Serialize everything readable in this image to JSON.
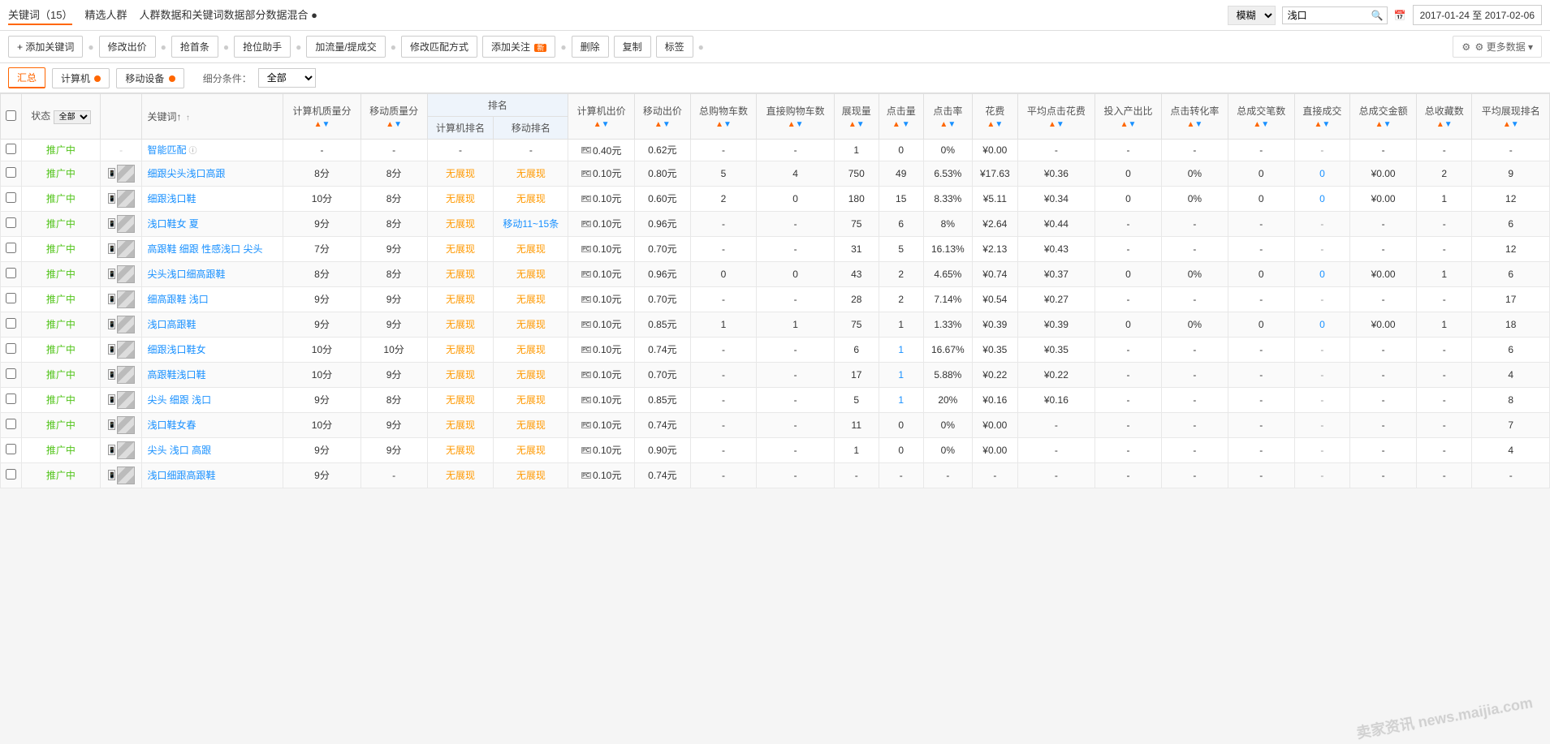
{
  "topBar": {
    "tabs": [
      {
        "id": "keywords",
        "label": "关键词（15）",
        "active": true
      },
      {
        "id": "target",
        "label": "精选人群",
        "active": false
      },
      {
        "id": "combined",
        "label": "人群数据和关键词数据部分数据混合 ●",
        "active": false
      }
    ],
    "filterSelect": "模糊",
    "filterSelect2": "浅口",
    "searchPlaceholder": "",
    "dateRange": "2017-01-24 至 2017-02-06"
  },
  "toolbar": {
    "addKeyword": "+ 添加关键词",
    "modifyBid": "修改出价",
    "topBid": "抢首条",
    "assistBid": "抢位助手",
    "boostFlow": "加流量/提成交",
    "modifyMatch": "修改匹配方式",
    "addFollow": "添加关注",
    "followNew": "新",
    "delete": "删除",
    "copy": "复制",
    "tag": "标签",
    "moreData": "⚙ 更多数据"
  },
  "filterBar": {
    "tabs": [
      {
        "id": "summary",
        "label": "汇总",
        "active": true
      },
      {
        "id": "pc",
        "label": "计算机",
        "active": false,
        "dot": true
      },
      {
        "id": "mobile",
        "label": "移动设备",
        "active": false,
        "dot": true
      }
    ],
    "subFilterLabel": "细分条件：",
    "subFilterValue": "全部"
  },
  "tableHeaders": {
    "select": "",
    "status": "状态",
    "statusFilter": "全部",
    "images": "",
    "keyword": "关键词↑",
    "pcQuality": "计算机质量分",
    "mobileQuality": "移动质量分",
    "pcRank": "计算机排名",
    "mobileRank": "移动排名",
    "pcBid": "计算机出价",
    "mobileBid": "移动出价",
    "totalCart": "总购物车数",
    "directCart": "直接购物车数",
    "impressions": "展现量",
    "clicks": "点击量",
    "ctr": "点击率",
    "cost": "花费",
    "avgClick": "平均点击花费",
    "roi": "投入产出比",
    "convRate": "点击转化率",
    "totalOrders": "总成交笔数",
    "directOrders": "直接成交",
    "totalSales": "总成交金额",
    "totalCollect": "总收藏数",
    "avgRank": "平均展现排名"
  },
  "rows": [
    {
      "status": "推广中",
      "isSpecial": true,
      "keyword": "智能匹配",
      "pcQuality": "-",
      "mobileQuality": "-",
      "pcRank": "-",
      "mobileRank": "-",
      "pcBid": "0.40元",
      "mobileBid": "0.62元",
      "totalCart": "-",
      "directCart": "-",
      "impressions": "1",
      "clicks": "0",
      "ctr": "0%",
      "cost": "¥0.00",
      "avgClick": "-",
      "roi": "-",
      "convRate": "-",
      "totalOrders": "-",
      "directOrders": "-",
      "totalSales": "-",
      "totalCollect": "-",
      "avgRank": "-",
      "hasImages": false
    },
    {
      "status": "推广中",
      "keyword": "细跟尖头浅口高跟",
      "pcQuality": "8分",
      "mobileQuality": "8分",
      "pcRank": "无展现",
      "mobileRank": "无展现",
      "pcBid": "0.10元",
      "mobileBid": "0.80元",
      "totalCart": "5",
      "directCart": "4",
      "impressions": "750",
      "clicks": "49",
      "ctr": "6.53%",
      "cost": "¥17.63",
      "avgClick": "¥0.36",
      "roi": "0",
      "convRate": "0%",
      "totalOrders": "0",
      "directOrders": "0",
      "totalSales": "¥0.00",
      "totalCollect": "2",
      "avgRank": "9",
      "hasImages": true
    },
    {
      "status": "推广中",
      "keyword": "细跟浅口鞋",
      "pcQuality": "10分",
      "mobileQuality": "8分",
      "pcRank": "无展现",
      "mobileRank": "无展现",
      "pcBid": "0.10元",
      "mobileBid": "0.60元",
      "totalCart": "2",
      "directCart": "0",
      "impressions": "180",
      "clicks": "15",
      "ctr": "8.33%",
      "cost": "¥5.11",
      "avgClick": "¥0.34",
      "roi": "0",
      "convRate": "0%",
      "totalOrders": "0",
      "directOrders": "0",
      "totalSales": "¥0.00",
      "totalCollect": "1",
      "avgRank": "12",
      "hasImages": true
    },
    {
      "status": "推广中",
      "keyword": "浅口鞋女 夏",
      "pcQuality": "9分",
      "mobileQuality": "8分",
      "pcRank": "无展现",
      "mobileRank": "移动11~15条",
      "pcBid": "0.10元",
      "mobileBid": "0.96元",
      "totalCart": "-",
      "directCart": "-",
      "impressions": "75",
      "clicks": "6",
      "ctr": "8%",
      "cost": "¥2.64",
      "avgClick": "¥0.44",
      "roi": "-",
      "convRate": "-",
      "totalOrders": "-",
      "directOrders": "-",
      "totalSales": "-",
      "totalCollect": "-",
      "avgRank": "6",
      "hasImages": true
    },
    {
      "status": "推广中",
      "keyword": "高跟鞋 细跟 性感浅口 尖头",
      "pcQuality": "7分",
      "mobileQuality": "9分",
      "pcRank": "无展现",
      "mobileRank": "无展现",
      "pcBid": "0.10元",
      "mobileBid": "0.70元",
      "totalCart": "-",
      "directCart": "-",
      "impressions": "31",
      "clicks": "5",
      "ctr": "16.13%",
      "cost": "¥2.13",
      "avgClick": "¥0.43",
      "roi": "-",
      "convRate": "-",
      "totalOrders": "-",
      "directOrders": "-",
      "totalSales": "-",
      "totalCollect": "-",
      "avgRank": "12",
      "hasImages": true
    },
    {
      "status": "推广中",
      "keyword": "尖头浅口细高跟鞋",
      "pcQuality": "8分",
      "mobileQuality": "8分",
      "pcRank": "无展现",
      "mobileRank": "无展现",
      "pcBid": "0.10元",
      "mobileBid": "0.96元",
      "totalCart": "0",
      "directCart": "0",
      "impressions": "43",
      "clicks": "2",
      "ctr": "4.65%",
      "cost": "¥0.74",
      "avgClick": "¥0.37",
      "roi": "0",
      "convRate": "0%",
      "totalOrders": "0",
      "directOrders": "0",
      "totalSales": "¥0.00",
      "totalCollect": "1",
      "avgRank": "6",
      "hasImages": true
    },
    {
      "status": "推广中",
      "keyword": "细高跟鞋 浅口",
      "pcQuality": "9分",
      "mobileQuality": "9分",
      "pcRank": "无展现",
      "mobileRank": "无展现",
      "pcBid": "0.10元",
      "mobileBid": "0.70元",
      "totalCart": "-",
      "directCart": "-",
      "impressions": "28",
      "clicks": "2",
      "ctr": "7.14%",
      "cost": "¥0.54",
      "avgClick": "¥0.27",
      "roi": "-",
      "convRate": "-",
      "totalOrders": "-",
      "directOrders": "-",
      "totalSales": "-",
      "totalCollect": "-",
      "avgRank": "17",
      "hasImages": true
    },
    {
      "status": "推广中",
      "keyword": "浅口高跟鞋",
      "pcQuality": "9分",
      "mobileQuality": "9分",
      "pcRank": "无展现",
      "mobileRank": "无展现",
      "pcBid": "0.10元",
      "mobileBid": "0.85元",
      "totalCart": "1",
      "directCart": "1",
      "impressions": "75",
      "clicks": "1",
      "ctr": "1.33%",
      "cost": "¥0.39",
      "avgClick": "¥0.39",
      "roi": "0",
      "convRate": "0%",
      "totalOrders": "0",
      "directOrders": "0",
      "totalSales": "¥0.00",
      "totalCollect": "1",
      "avgRank": "18",
      "hasImages": true
    },
    {
      "status": "推广中",
      "keyword": "细跟浅口鞋女",
      "pcQuality": "10分",
      "mobileQuality": "10分",
      "pcRank": "无展现",
      "mobileRank": "无展现",
      "pcBid": "0.10元",
      "mobileBid": "0.74元",
      "totalCart": "-",
      "directCart": "-",
      "impressions": "6",
      "clicks": "1",
      "ctr": "16.67%",
      "cost": "¥0.35",
      "avgClick": "¥0.35",
      "roi": "-",
      "convRate": "-",
      "totalOrders": "-",
      "directOrders": "-",
      "totalSales": "-",
      "totalCollect": "-",
      "avgRank": "6",
      "hasImages": true,
      "clickHighlight": true
    },
    {
      "status": "推广中",
      "keyword": "高跟鞋浅口鞋",
      "pcQuality": "10分",
      "mobileQuality": "9分",
      "pcRank": "无展现",
      "mobileRank": "无展现",
      "pcBid": "0.10元",
      "mobileBid": "0.70元",
      "totalCart": "-",
      "directCart": "-",
      "impressions": "17",
      "clicks": "1",
      "ctr": "5.88%",
      "cost": "¥0.22",
      "avgClick": "¥0.22",
      "roi": "-",
      "convRate": "-",
      "totalOrders": "-",
      "directOrders": "-",
      "totalSales": "-",
      "totalCollect": "-",
      "avgRank": "4",
      "hasImages": true,
      "clickHighlight": true
    },
    {
      "status": "推广中",
      "keyword": "尖头 细跟 浅口",
      "pcQuality": "9分",
      "mobileQuality": "8分",
      "pcRank": "无展现",
      "mobileRank": "无展现",
      "pcBid": "0.10元",
      "mobileBid": "0.85元",
      "totalCart": "-",
      "directCart": "-",
      "impressions": "5",
      "clicks": "1",
      "ctr": "20%",
      "cost": "¥0.16",
      "avgClick": "¥0.16",
      "roi": "-",
      "convRate": "-",
      "totalOrders": "-",
      "directOrders": "-",
      "totalSales": "-",
      "totalCollect": "-",
      "avgRank": "8",
      "hasImages": true,
      "clickHighlight": true
    },
    {
      "status": "推广中",
      "keyword": "浅口鞋女春",
      "pcQuality": "10分",
      "mobileQuality": "9分",
      "pcRank": "无展现",
      "mobileRank": "无展现",
      "pcBid": "0.10元",
      "mobileBid": "0.74元",
      "totalCart": "-",
      "directCart": "-",
      "impressions": "11",
      "clicks": "0",
      "ctr": "0%",
      "cost": "¥0.00",
      "avgClick": "-",
      "roi": "-",
      "convRate": "-",
      "totalOrders": "-",
      "directOrders": "-",
      "totalSales": "-",
      "totalCollect": "-",
      "avgRank": "7",
      "hasImages": true
    },
    {
      "status": "推广中",
      "keyword": "尖头 浅口 高跟",
      "pcQuality": "9分",
      "mobileQuality": "9分",
      "pcRank": "无展现",
      "mobileRank": "无展现",
      "pcBid": "0.10元",
      "mobileBid": "0.90元",
      "totalCart": "-",
      "directCart": "-",
      "impressions": "1",
      "clicks": "0",
      "ctr": "0%",
      "cost": "¥0.00",
      "avgClick": "-",
      "roi": "-",
      "convRate": "-",
      "totalOrders": "-",
      "directOrders": "-",
      "totalSales": "-",
      "totalCollect": "-",
      "avgRank": "4",
      "hasImages": true
    },
    {
      "status": "推广中",
      "keyword": "浅口细跟高跟鞋",
      "pcQuality": "9分",
      "mobileQuality": "-",
      "pcRank": "无展现",
      "mobileRank": "无展现",
      "pcBid": "0.10元",
      "mobileBid": "0.74元",
      "totalCart": "-",
      "directCart": "-",
      "impressions": "-",
      "clicks": "-",
      "ctr": "-",
      "cost": "-",
      "avgClick": "-",
      "roi": "-",
      "convRate": "-",
      "totalOrders": "-",
      "directOrders": "-",
      "totalSales": "-",
      "totalCollect": "-",
      "avgRank": "-",
      "hasImages": true
    }
  ],
  "watermark": "卖家资讯 news.maijia.com"
}
